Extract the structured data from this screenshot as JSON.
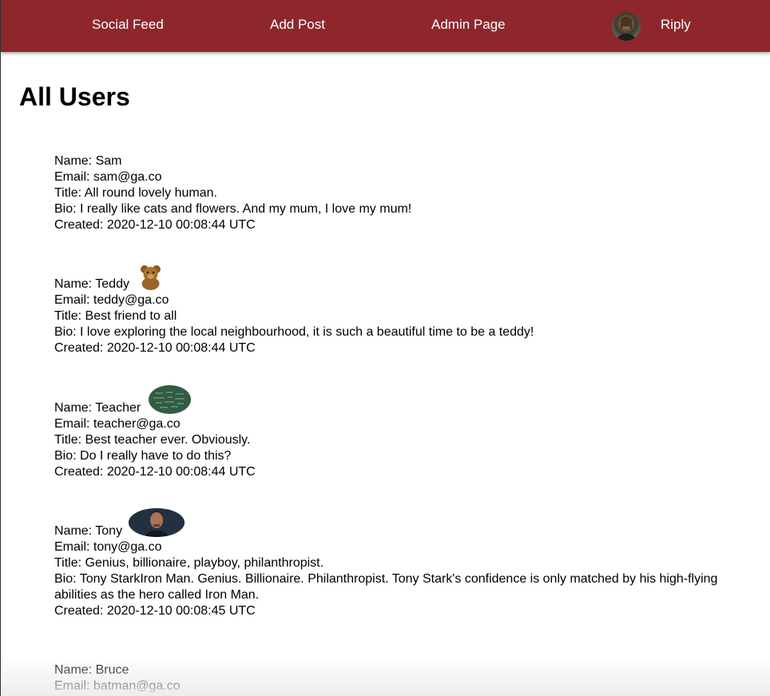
{
  "nav": {
    "feed_label": "Social Feed",
    "add_label": "Add Post",
    "admin_label": "Admin Page",
    "user_label": "Riply",
    "bar_color": "#8e272c",
    "avatar_icon": "user-avatar-icon"
  },
  "page": {
    "title": "All Users"
  },
  "users": [
    {
      "name": "Name: Sam",
      "email": "Email: sam@ga.co",
      "title": "Title: All round lovely human.",
      "bio": "Bio: I really like cats and flowers. And my mum, I love my mum!",
      "created": "Created: 2020-12-10 00:08:44 UTC"
    },
    {
      "name": "Name: Teddy",
      "email": "Email: teddy@ga.co",
      "title": "Title: Best friend to all",
      "bio": "Bio: I love exploring the local neighbourhood, it is such a beautiful time to be a teddy!",
      "created": "Created: 2020-12-10 00:08:44 UTC",
      "avatar_icon": "teddy-bear-icon"
    },
    {
      "name": "Name: Teacher",
      "email": "Email: teacher@ga.co",
      "title": "Title: Best teacher ever. Obviously.",
      "bio": "Bio: Do I really have to do this?",
      "created": "Created: 2020-12-10 00:08:44 UTC",
      "avatar_icon": "chalkboard-icon"
    },
    {
      "name": "Name: Tony",
      "email": "Email: tony@ga.co",
      "title": "Title: Genius, billionaire, playboy, philanthropist.",
      "bio": "Bio: Tony StarkIron Man. Genius. Billionaire. Philanthropist. Tony Stark's confidence is only matched by his high-flying abilities as the hero called Iron Man.",
      "created": "Created: 2020-12-10 00:08:45 UTC",
      "avatar_icon": "person-photo-icon"
    },
    {
      "name": "Name: Bruce",
      "email": "Email: batman@ga.co"
    }
  ]
}
